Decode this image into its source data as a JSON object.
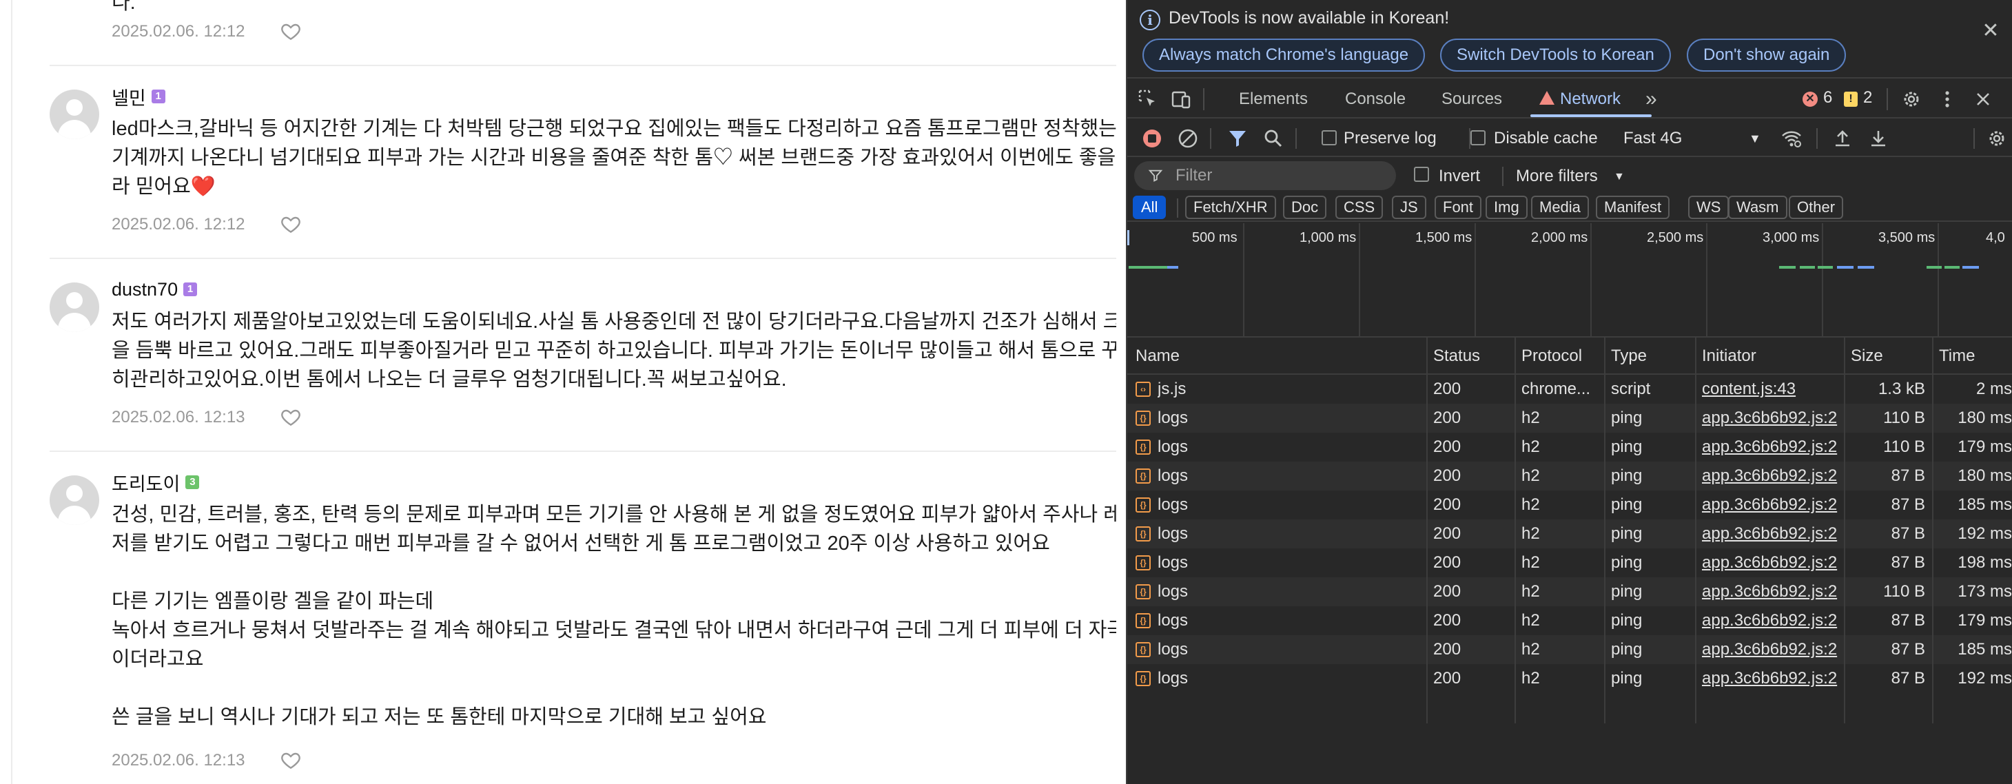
{
  "page": {
    "cut_top_text": "다.",
    "comments": [
      {
        "name": "넬민",
        "level": "1",
        "level_color": "#a97ce6",
        "lines": [
          "led마스크,갈바닉 등 어지간한 기계는 다 처박템 당근행 되었구요 집에있는 팩들도 다정리하고 요즘 톰프로그램만 정착했는데",
          "기계까지 나온다니 넘기대되요 피부과 가는 시간과 비용을 줄여준 착한 톰♡ 써본 브랜드중 가장 효과있어서 이번에도 좋을거",
          "라 믿어요❤️"
        ],
        "date": "2025.02.06. 12:12"
      },
      {
        "name": "dustn70",
        "level": "1",
        "level_color": "#a97ce6",
        "lines": [
          "저도 여러가지 제품알아보고있었는데 도움이되네요.사실 톰 사용중인데 전 많이 당기더라구요.다음날까지 건조가 심해서 크림",
          "을 듬뿍 바르고 있어요.그래도 피부좋아질거라 믿고 꾸준히 하고있습니다. 피부과 가기는 돈이너무 많이들고 해서 톰으로 꾸준",
          "히관리하고있어요.이번 톰에서 나오는 더 글루우 엄청기대됩니다.꼭 써보고싶어요."
        ],
        "date": "2025.02.06. 12:13"
      },
      {
        "name": "도리도이",
        "level": "3",
        "level_color": "#6cc36a",
        "lines": [
          "건성, 민감, 트러블, 홍조, 탄력 등의 문제로 피부과며 모든 기기를 안 사용해 본 게 없을 정도였어요 피부가 얇아서 주사나 레이",
          "저를 받기도 어렵고 그렇다고 매번 피부과를 갈 수 없어서 선택한 게 톰 프로그램이었고 20주 이상 사용하고 있어요",
          "",
          "다른 기기는 엠플이랑 겔을 같이 파는데",
          "녹아서 흐르거나 뭉쳐서 덧발라주는 걸 계속 해야되고 덧발라도 결국엔 닦아 내면서 하더라구여 근데 그게 더 피부에 더 자극적",
          "이더라고요",
          "",
          "쓴 글을 보니 역시나 기대가 되고 저는 또 톰한테 마지막으로 기대해 보고 싶어요"
        ],
        "date": "2025.02.06. 12:13"
      }
    ],
    "first_date": "2025.02.06. 12:12"
  },
  "devtools": {
    "info": {
      "message": "DevTools is now available in Korean!",
      "btn_match": "Always match Chrome's language",
      "btn_switch": "Switch DevTools to Korean",
      "btn_dont": "Don't show again"
    },
    "tabs": {
      "elements": "Elements",
      "console": "Console",
      "sources": "Sources",
      "network": "Network",
      "error_count": "6",
      "warning_count": "2"
    },
    "toolbar": {
      "preserve_log": "Preserve log",
      "disable_cache": "Disable cache",
      "throttle": "Fast 4G"
    },
    "filter": {
      "placeholder": "Filter",
      "invert": "Invert",
      "more_filters": "More filters"
    },
    "types": [
      "All",
      "Fetch/XHR",
      "Doc",
      "CSS",
      "JS",
      "Font",
      "Img",
      "Media",
      "Manifest",
      "WS",
      "Wasm",
      "Other"
    ],
    "timeline_labels": [
      "500 ms",
      "1,000 ms",
      "1,500 ms",
      "2,000 ms",
      "2,500 ms",
      "3,000 ms",
      "3,500 ms",
      "4,0"
    ],
    "columns": {
      "name": "Name",
      "status": "Status",
      "protocol": "Protocol",
      "type": "Type",
      "initiator": "Initiator",
      "size": "Size",
      "time": "Time"
    },
    "requests": [
      {
        "name": "js.js",
        "status": "200",
        "protocol": "chrome...",
        "type": "script",
        "initiator": "content.js:43",
        "size": "1.3 kB",
        "time": "2 ms"
      },
      {
        "name": "logs",
        "status": "200",
        "protocol": "h2",
        "type": "ping",
        "initiator": "app.3c6b6b92.js:2",
        "size": "110 B",
        "time": "180 ms"
      },
      {
        "name": "logs",
        "status": "200",
        "protocol": "h2",
        "type": "ping",
        "initiator": "app.3c6b6b92.js:2",
        "size": "110 B",
        "time": "179 ms"
      },
      {
        "name": "logs",
        "status": "200",
        "protocol": "h2",
        "type": "ping",
        "initiator": "app.3c6b6b92.js:2",
        "size": "87 B",
        "time": "180 ms"
      },
      {
        "name": "logs",
        "status": "200",
        "protocol": "h2",
        "type": "ping",
        "initiator": "app.3c6b6b92.js:2",
        "size": "87 B",
        "time": "185 ms"
      },
      {
        "name": "logs",
        "status": "200",
        "protocol": "h2",
        "type": "ping",
        "initiator": "app.3c6b6b92.js:2",
        "size": "87 B",
        "time": "192 ms"
      },
      {
        "name": "logs",
        "status": "200",
        "protocol": "h2",
        "type": "ping",
        "initiator": "app.3c6b6b92.js:2",
        "size": "87 B",
        "time": "198 ms"
      },
      {
        "name": "logs",
        "status": "200",
        "protocol": "h2",
        "type": "ping",
        "initiator": "app.3c6b6b92.js:2",
        "size": "110 B",
        "time": "173 ms"
      },
      {
        "name": "logs",
        "status": "200",
        "protocol": "h2",
        "type": "ping",
        "initiator": "app.3c6b6b92.js:2",
        "size": "87 B",
        "time": "179 ms"
      },
      {
        "name": "logs",
        "status": "200",
        "protocol": "h2",
        "type": "ping",
        "initiator": "app.3c6b6b92.js:2",
        "size": "87 B",
        "time": "185 ms"
      },
      {
        "name": "logs",
        "status": "200",
        "protocol": "h2",
        "type": "ping",
        "initiator": "app.3c6b6b92.js:2",
        "size": "87 B",
        "time": "192 ms"
      }
    ],
    "colors": {
      "accent": "#a8c7fa",
      "error": "#f28b82",
      "warning": "#fdd663",
      "record": "#f28b82"
    }
  }
}
